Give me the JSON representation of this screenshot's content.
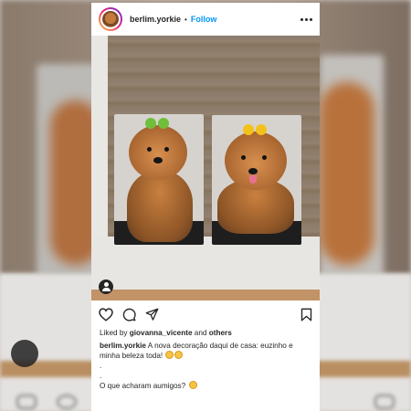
{
  "post": {
    "username": "berlim.yorkie",
    "separator": "•",
    "follow_label": "Follow",
    "likes": {
      "prefix": "Liked by",
      "user": "giovanna_vicente",
      "conjunction": "and",
      "others": "others"
    },
    "caption": {
      "username": "berlim.yorkie",
      "text_1": "A nova decoração daqui de casa: euzinho e minha beleza toda!",
      "dot_1": ".",
      "dot_2": ".",
      "text_2": "O que acharam aumigos?"
    }
  },
  "icons": {
    "more": "more-options-icon",
    "like": "heart-icon",
    "comment": "comment-icon",
    "share": "share-icon",
    "save": "bookmark-icon",
    "tag": "user-tag-icon"
  },
  "colors": {
    "accent": "#0095f6",
    "text": "#262626",
    "bow_green": "#6fbf3a",
    "bow_yellow": "#f2c21b"
  }
}
